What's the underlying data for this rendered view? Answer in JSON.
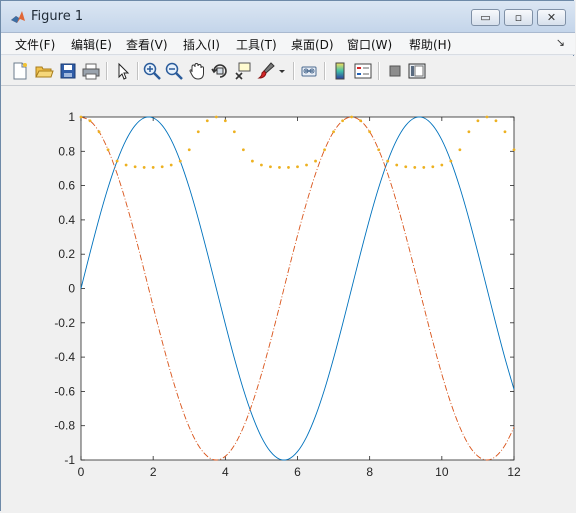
{
  "window": {
    "title": "Figure 1",
    "buttons": {
      "minimize": "▭",
      "restore": "▫",
      "close": "✕"
    }
  },
  "menu": {
    "items": [
      "文件(F)",
      "编辑(E)",
      "查看(V)",
      "插入(I)",
      "工具(T)",
      "桌面(D)",
      "窗口(W)",
      "帮助(H)"
    ],
    "overflow": "↘"
  },
  "toolbar": {
    "icons": [
      "new-figure-icon",
      "open-file-icon",
      "save-icon",
      "print-icon",
      "select-arrow-icon",
      "zoom-in-icon",
      "zoom-out-icon",
      "pan-hand-icon",
      "rotate-3d-icon",
      "data-cursor-icon",
      "brush-icon",
      "brush-dropdown-icon",
      "link-plot-icon",
      "colorbar-icon",
      "legend-icon",
      "hide-plot-tools-icon",
      "show-plot-tools-icon"
    ]
  },
  "colors": {
    "series_blue": "#0072bd",
    "series_red": "#d95319",
    "series_orange": "#edb120"
  },
  "chart_data": {
    "type": "line",
    "title": "",
    "xlabel": "",
    "ylabel": "",
    "xlim": [
      0,
      12
    ],
    "ylim": [
      -1,
      1
    ],
    "xticks": [
      "0",
      "2",
      "4",
      "6",
      "8",
      "10",
      "12"
    ],
    "yticks": [
      "1",
      "0.8",
      "0.6",
      "0.4",
      "0.2",
      "0",
      "-0.2",
      "-0.4",
      "-0.6",
      "-0.8",
      "-1"
    ],
    "grid": false,
    "legend": null,
    "series": [
      {
        "style": "solid",
        "color": "#0072bd",
        "x": [
          0,
          0.25,
          0.5,
          0.75,
          1,
          1.25,
          1.5,
          1.75,
          2,
          2.25,
          2.5,
          2.75,
          3,
          3.25,
          3.5,
          3.75,
          4,
          4.25,
          4.5,
          4.75,
          5,
          5.25,
          5.5,
          5.75,
          6,
          6.25,
          6.5,
          6.75,
          7,
          7.25,
          7.5,
          7.75,
          8,
          8.25,
          8.5,
          8.75,
          9,
          9.25,
          9.5,
          9.75,
          10,
          10.25,
          10.5,
          10.75,
          11,
          11.25,
          11.5,
          11.75,
          12
        ],
        "y": [
          0,
          0.208,
          0.407,
          0.588,
          0.743,
          0.866,
          0.951,
          0.995,
          0.995,
          0.951,
          0.866,
          0.743,
          0.588,
          0.407,
          0.208,
          0,
          -0.208,
          -0.407,
          -0.588,
          -0.743,
          -0.866,
          -0.951,
          -0.995,
          -0.995,
          -0.951,
          -0.866,
          -0.743,
          -0.588,
          -0.407,
          -0.208,
          0,
          0.208,
          0.407,
          0.588,
          0.743,
          0.866,
          0.951,
          0.995,
          0.995,
          0.951,
          0.866,
          0.743,
          0.588,
          0.407,
          0.208,
          0,
          -0.208,
          -0.407,
          -0.588
        ]
      },
      {
        "style": "dash-dot",
        "color": "#d95319",
        "x": [
          0,
          0.25,
          0.5,
          0.75,
          1,
          1.25,
          1.5,
          1.75,
          2,
          2.25,
          2.5,
          2.75,
          3,
          3.25,
          3.5,
          3.75,
          4,
          4.25,
          4.5,
          4.75,
          5,
          5.25,
          5.5,
          5.75,
          6,
          6.25,
          6.5,
          6.75,
          7,
          7.25,
          7.5,
          7.75,
          8,
          8.25,
          8.5,
          8.75,
          9,
          9.25,
          9.5,
          9.75,
          10,
          10.25,
          10.5,
          10.75,
          11,
          11.25,
          11.5,
          11.75,
          12
        ],
        "y": [
          1,
          0.978,
          0.914,
          0.809,
          0.669,
          0.5,
          0.309,
          0.105,
          -0.105,
          -0.309,
          -0.5,
          -0.669,
          -0.809,
          -0.914,
          -0.978,
          -1,
          -0.978,
          -0.914,
          -0.809,
          -0.669,
          -0.5,
          -0.309,
          -0.105,
          0.105,
          0.309,
          0.5,
          0.669,
          0.809,
          0.914,
          0.978,
          1,
          0.978,
          0.914,
          0.809,
          0.669,
          0.5,
          0.309,
          0.105,
          -0.105,
          -0.309,
          -0.5,
          -0.669,
          -0.809,
          -0.914,
          -0.978,
          -1,
          -0.978,
          -0.914,
          -0.809
        ]
      },
      {
        "style": "dotted-markers",
        "color": "#edb120",
        "x": [
          0,
          0.25,
          0.5,
          0.75,
          1,
          1.25,
          1.5,
          1.75,
          2,
          2.25,
          2.5,
          2.75,
          3,
          3.25,
          3.5,
          3.75,
          4,
          4.25,
          4.5,
          4.75,
          5,
          5.25,
          5.5,
          5.75,
          6,
          6.25,
          6.5,
          6.75,
          7,
          7.25,
          7.5,
          7.75,
          8,
          8.25,
          8.5,
          8.75,
          9,
          9.25,
          9.5,
          9.75,
          10,
          10.25,
          10.5,
          10.75,
          11,
          11.25,
          11.5,
          11.75,
          12
        ],
        "y": [
          1,
          0.978,
          0.914,
          0.809,
          0.743,
          0.72,
          0.71,
          0.706,
          0.706,
          0.71,
          0.72,
          0.743,
          0.809,
          0.914,
          0.978,
          1,
          0.978,
          0.914,
          0.809,
          0.743,
          0.72,
          0.71,
          0.706,
          0.706,
          0.71,
          0.72,
          0.743,
          0.809,
          0.914,
          0.978,
          1,
          0.978,
          0.914,
          0.809,
          0.743,
          0.72,
          0.71,
          0.706,
          0.706,
          0.71,
          0.72,
          0.743,
          0.809,
          0.914,
          0.978,
          1,
          0.978,
          0.914,
          0.809
        ]
      }
    ]
  }
}
